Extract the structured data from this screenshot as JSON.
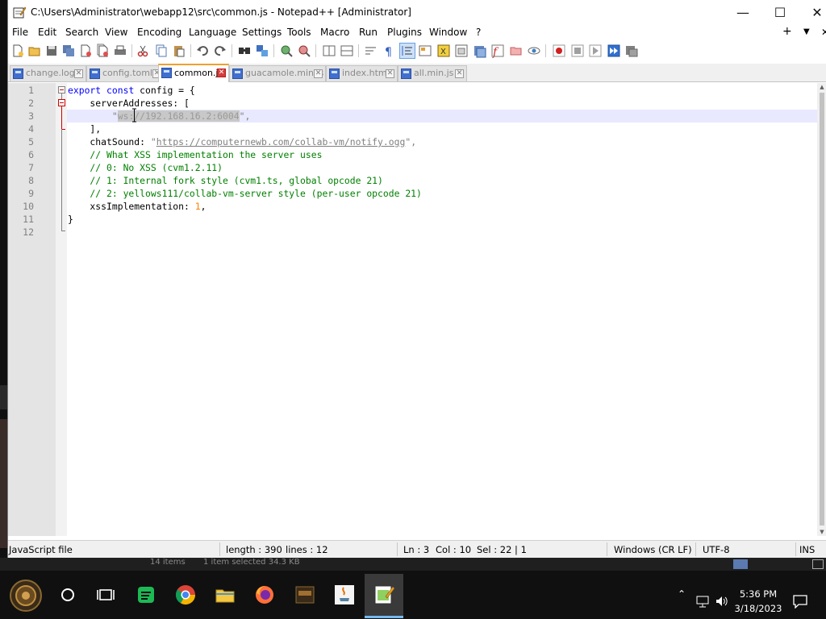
{
  "window": {
    "title": "C:\\Users\\Administrator\\webapp12\\src\\common.js - Notepad++ [Administrator]",
    "minimize": "—",
    "maximize": "☐",
    "close": "✕"
  },
  "menu": {
    "items": [
      "File",
      "Edit",
      "Search",
      "View",
      "Encoding",
      "Language",
      "Settings",
      "Tools",
      "Macro",
      "Run",
      "Plugins",
      "Window",
      "?"
    ],
    "extra_add": "+",
    "extra_dropdown": "▼",
    "extra_close": "✕"
  },
  "toolbar": {
    "buttons": [
      "new",
      "open",
      "save",
      "save-all",
      "close",
      "close-all",
      "print",
      "cut",
      "copy",
      "paste",
      "undo",
      "redo",
      "find",
      "replace",
      "zoom-in",
      "zoom-out",
      "sync-vertical",
      "sync-horizontal",
      "word-wrap",
      "show-all-chars",
      "indent-guide",
      "user-defined-language",
      "document-map",
      "function-list",
      "folder-as-workspace",
      "monitoring",
      "record-macro",
      "stop-recording",
      "play-macro",
      "run-macro-multiple",
      "save-macro"
    ]
  },
  "tabs": [
    {
      "label": "change.log",
      "active": false
    },
    {
      "label": "config.toml",
      "active": false
    },
    {
      "label": "common.js",
      "active": true
    },
    {
      "label": "guacamole.min.js",
      "active": false
    },
    {
      "label": "index.html",
      "active": false
    },
    {
      "label": "all.min.js",
      "active": false
    }
  ],
  "editor": {
    "line_numbers": [
      "1",
      "2",
      "3",
      "4",
      "5",
      "6",
      "7",
      "8",
      "9",
      "10",
      "11",
      "12"
    ],
    "current_line": 3,
    "lines": {
      "l1_kw1": "export",
      "l1_kw2": "const",
      "l1_rest": " config = {",
      "l2": "    serverAddresses: [",
      "l3_indent": "        \"",
      "l3_selected": "ws://192.168.16.2:6004",
      "l3_end": "\",",
      "l4": "    ],",
      "l5_key": "    chatSound: ",
      "l5_q1": "\"",
      "l5_url": "https://computernewb.com/collab-vm/notify.ogg",
      "l5_end": "\",",
      "l6": "    // What XSS implementation the server uses",
      "l7": "    // 0: No XSS (cvm1.2.11)",
      "l8": "    // 1: Internal fork style (cvm1.ts, global opcode 21)",
      "l9": "    // 2: yellows111/collab-vm-server style (per-user opcode 21)",
      "l10_key": "    xssImplementation: ",
      "l10_num": "1",
      "l10_end": ",",
      "l11": "}",
      "l12": ""
    }
  },
  "statusbar": {
    "file_type": "JavaScript file",
    "length": "length : 390",
    "lines": "lines : 12",
    "ln": "Ln : 3",
    "col": "Col : 10",
    "sel": "Sel : 22 | 1",
    "eol": "Windows (CR LF)",
    "encoding": "UTF-8",
    "mode": "INS"
  },
  "behind_window": {
    "items_text": "14 items",
    "selected_text": "1 item selected  34.3 KB"
  },
  "taskbar": {
    "time": "5:36 PM",
    "date": "3/18/2023",
    "apps": [
      "start",
      "search",
      "task-view",
      "green-app",
      "chrome",
      "file-explorer",
      "firefox",
      "game",
      "java",
      "notepad-plus-plus"
    ]
  },
  "colors": {
    "keyword": "#0000ff",
    "string": "#808080",
    "comment": "#008000",
    "number": "#ff8000",
    "current_line": "#e8e8ff",
    "active_tab_accent": "#f0a030"
  }
}
